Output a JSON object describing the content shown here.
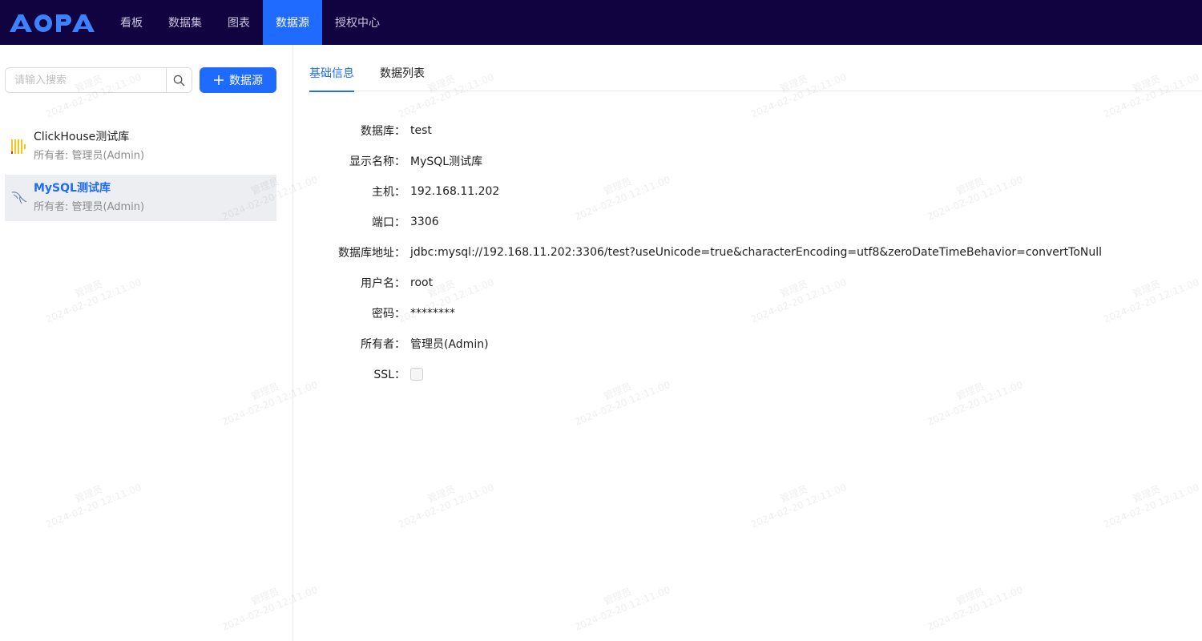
{
  "app": {
    "logo_text": "AOPA"
  },
  "nav": {
    "items": [
      {
        "label": "看板"
      },
      {
        "label": "数据集"
      },
      {
        "label": "图表"
      },
      {
        "label": "数据源"
      },
      {
        "label": "授权中心"
      }
    ],
    "active_index": 3
  },
  "sidebar": {
    "search_placeholder": "请输入搜索",
    "add_button_label": "数据源",
    "datasources": [
      {
        "name": "ClickHouse测试库",
        "owner": "所有者: 管理员(Admin)",
        "icon": "clickhouse-icon",
        "selected": false
      },
      {
        "name": "MySQL测试库",
        "owner": "所有者: 管理员(Admin)",
        "icon": "mysql-icon",
        "selected": true
      }
    ]
  },
  "tabs": [
    {
      "label": "基础信息",
      "active": true
    },
    {
      "label": "数据列表",
      "active": false
    }
  ],
  "details": {
    "database": {
      "label": "数据库：",
      "value": "test"
    },
    "display_name": {
      "label": "显示名称：",
      "value": "MySQL测试库"
    },
    "host": {
      "label": "主机：",
      "value": "192.168.11.202"
    },
    "port": {
      "label": "端口：",
      "value": "3306"
    },
    "url": {
      "label": "数据库地址：",
      "value": "jdbc:mysql://192.168.11.202:3306/test?useUnicode=true&characterEncoding=utf8&zeroDateTimeBehavior=convertToNull"
    },
    "username": {
      "label": "用户名：",
      "value": "root"
    },
    "password": {
      "label": "密码：",
      "value": "********"
    },
    "owner": {
      "label": "所有者：",
      "value": "管理员(Admin)"
    },
    "ssl": {
      "label": "SSL：",
      "checked": false
    }
  },
  "watermark": {
    "user": "管理员",
    "time": "2024-02-20 12:11:00"
  },
  "colors": {
    "topbar": "#10033f",
    "accent": "#1f6bff",
    "selected_bg": "#eceef2"
  }
}
